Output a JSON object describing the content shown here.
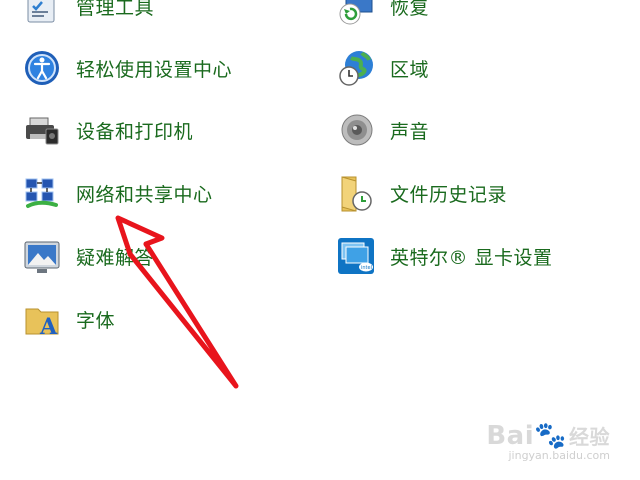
{
  "control_panel": {
    "left_items": [
      {
        "label": "管理工具",
        "icon": "admin-tools-icon"
      },
      {
        "label": "轻松使用设置中心",
        "icon": "ease-of-access-icon"
      },
      {
        "label": "设备和打印机",
        "icon": "printer-icon"
      },
      {
        "label": "网络和共享中心",
        "icon": "network-icon"
      },
      {
        "label": "疑难解答",
        "icon": "troubleshoot-icon"
      },
      {
        "label": "字体",
        "icon": "fonts-icon"
      }
    ],
    "right_items": [
      {
        "label": "恢复",
        "icon": "recovery-icon"
      },
      {
        "label": "区域",
        "icon": "region-globe-icon"
      },
      {
        "label": "声音",
        "icon": "speaker-icon"
      },
      {
        "label": "文件历史记录",
        "icon": "file-history-icon"
      },
      {
        "label": "英特尔® 显卡设置",
        "icon": "intel-graphics-icon"
      }
    ],
    "link_color": "#1a6a1e"
  },
  "annotation": {
    "arrow_color": "#e8141c",
    "target": "网络和共享中心"
  },
  "watermark": {
    "brand": "Bai",
    "brand_cn": "经验",
    "url": "jingyan.baidu.com"
  }
}
